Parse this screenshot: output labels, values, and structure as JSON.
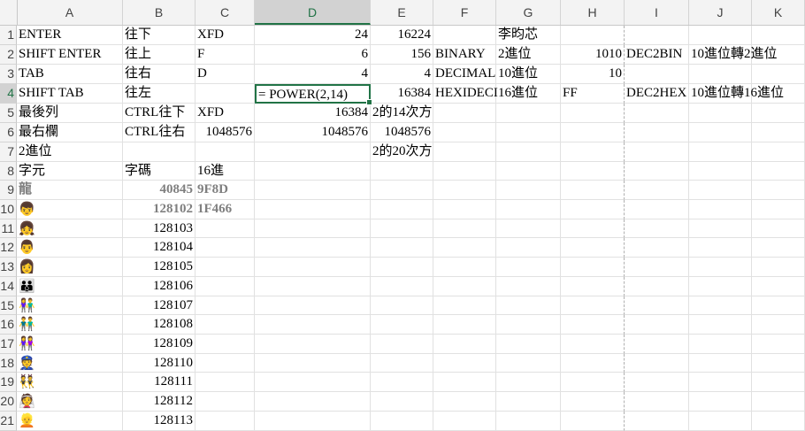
{
  "columns": [
    "A",
    "B",
    "C",
    "D",
    "E",
    "F",
    "G",
    "H",
    "I",
    "J",
    "K"
  ],
  "selected_column": "D",
  "selected_row": "4",
  "rows": [
    {
      "n": "1",
      "cells": {
        "A": "ENTER",
        "B": "往下",
        "C": "XFD",
        "D": "24",
        "E": "16224",
        "G": "李昀芯"
      }
    },
    {
      "n": "2",
      "cells": {
        "A": "SHIFT ENTER",
        "B": "往上",
        "C": "F",
        "D": "6",
        "E": "156",
        "F": "BINARY",
        "G": "2進位",
        "H": "1010",
        "I": "DEC2BIN",
        "J": "10進位轉2進位"
      }
    },
    {
      "n": "3",
      "cells": {
        "A": "TAB",
        "B": "往右",
        "C": "D",
        "D": "4",
        "E": "4",
        "F": "DECIMAL",
        "G": "10進位",
        "H": "10"
      }
    },
    {
      "n": "4",
      "cells": {
        "A": "SHIFT TAB",
        "B": "往左",
        "D": "= POWER(2,14)",
        "E": "16384",
        "F": "HEXIDECI",
        "G": "16進位",
        "H": "FF",
        "I": "DEC2HEX",
        "J": "10進位轉16進位"
      }
    },
    {
      "n": "5",
      "cells": {
        "A": "最後列",
        "B": "CTRL往下",
        "C": "XFD",
        "D": "16384",
        "E": "2的14次方"
      }
    },
    {
      "n": "6",
      "cells": {
        "A": "最右欄",
        "B": "CTRL往右",
        "C": "1048576",
        "D": "1048576",
        "E": "1048576"
      }
    },
    {
      "n": "7",
      "cells": {
        "A": "2進位",
        "E": "2的20次方"
      }
    },
    {
      "n": "8",
      "cells": {
        "A": "字元",
        "B": "字碼",
        "C": "16進"
      }
    },
    {
      "n": "9",
      "cells": {
        "A": "龍",
        "B": "40845",
        "C": "9F8D"
      }
    },
    {
      "n": "10",
      "cells": {
        "A": "👦",
        "B": "128102",
        "C": "1F466"
      }
    },
    {
      "n": "11",
      "cells": {
        "A": "👧",
        "B": "128103"
      }
    },
    {
      "n": "12",
      "cells": {
        "A": "👨",
        "B": "128104"
      }
    },
    {
      "n": "13",
      "cells": {
        "A": "👩",
        "B": "128105"
      }
    },
    {
      "n": "14",
      "cells": {
        "A": "👪",
        "B": "128106"
      }
    },
    {
      "n": "15",
      "cells": {
        "A": "👫",
        "B": "128107"
      }
    },
    {
      "n": "16",
      "cells": {
        "A": "👬",
        "B": "128108"
      }
    },
    {
      "n": "17",
      "cells": {
        "A": "👭",
        "B": "128109"
      }
    },
    {
      "n": "18",
      "cells": {
        "A": "👮",
        "B": "128110"
      }
    },
    {
      "n": "19",
      "cells": {
        "A": "👯",
        "B": "128111"
      }
    },
    {
      "n": "20",
      "cells": {
        "A": "👰",
        "B": "128112"
      }
    },
    {
      "n": "21",
      "cells": {
        "A": "👱",
        "B": "128113"
      }
    }
  ],
  "accent_color": "#217346"
}
